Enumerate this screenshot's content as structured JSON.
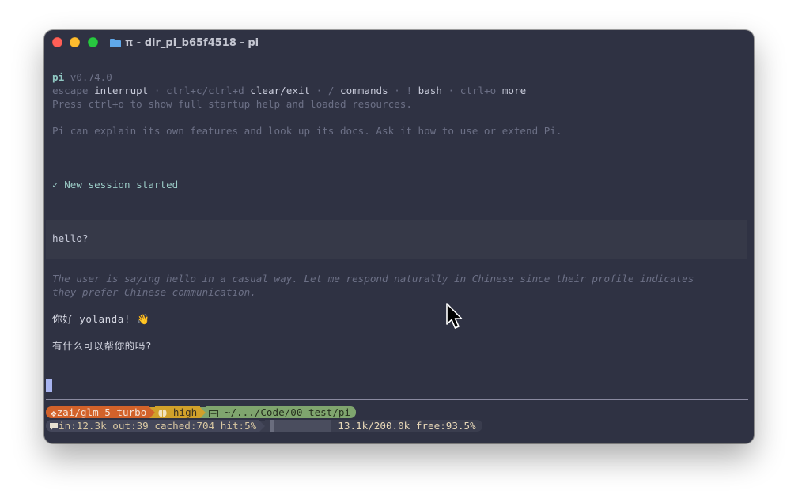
{
  "window": {
    "title": "π - dir_pi_b65f4518 - pi"
  },
  "header": {
    "app_name": "pi",
    "version": "v0.74.0",
    "shortcuts": [
      {
        "key": "escape",
        "action": "interrupt"
      },
      {
        "key": "ctrl+c/ctrl+d",
        "action": "clear/exit"
      },
      {
        "key": "/",
        "action": "commands"
      },
      {
        "key": "!",
        "action": "bash"
      },
      {
        "key": "ctrl+o",
        "action": "more"
      }
    ],
    "separator": " · ",
    "startup_hint": "Press ctrl+o to show full startup help and loaded resources.",
    "docs_hint": "Pi can explain its own features and look up its docs. Ask it how to use or extend Pi."
  },
  "session": {
    "check": "✓",
    "status": "New session started"
  },
  "conversation": {
    "user_message": "hello?",
    "thinking_lines": [
      "The user is saying hello in a casual way. Let me respond naturally in Chinese since their profile indicates",
      "they prefer Chinese communication."
    ],
    "reply_line_1": "你好 yolanda! 👋",
    "reply_line_2": "有什么可以帮你的吗?"
  },
  "status_bar": {
    "model": "zai/glm-5-turbo",
    "thinking_level": "high",
    "directory": "~/.../Code/00-test/pi",
    "tokens_in": "in:12.3k",
    "tokens_out": "out:39",
    "cached": "cached:704",
    "hit": "hit:5%",
    "context_usage": "13.1k/200.0k",
    "context_free": "free:93.5%",
    "context_used_fraction": 0.065,
    "colors": {
      "model": "#d2622a",
      "thinking": "#d1a12a",
      "directory": "#7fa56e"
    }
  }
}
